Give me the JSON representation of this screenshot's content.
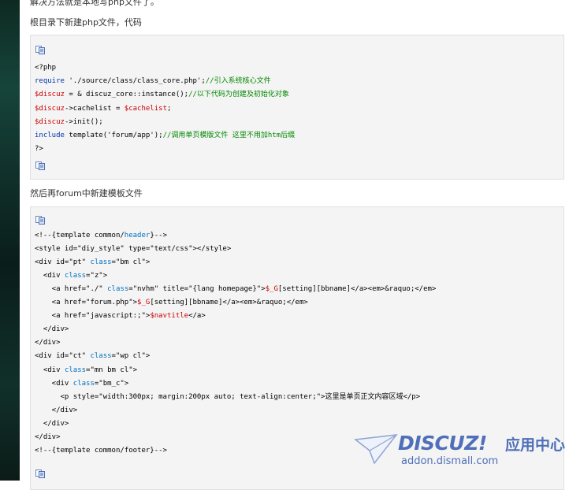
{
  "article": {
    "para_top": "解决方法就是本地写php文件了。",
    "para_1": "根目录下新建php文件，代码",
    "para_2": "然后再forum中新建模板文件"
  },
  "icons": {
    "copy": "copy-code-icon"
  },
  "code_php": {
    "lines": [
      [
        {
          "t": "<?php",
          "c": "str"
        }
      ],
      [
        {
          "t": "require",
          "c": "kw"
        },
        {
          "t": " './source/class/class_core.php';",
          "c": "str"
        },
        {
          "t": "//引入系统核心文件",
          "c": "cmt"
        }
      ],
      [
        {
          "t": "$discuz",
          "c": "var"
        },
        {
          "t": " = & discuz_core::instance();",
          "c": "str"
        },
        {
          "t": "//以下代码为创建及初始化对象",
          "c": "cmt"
        }
      ],
      [
        {
          "t": "$discuz",
          "c": "var"
        },
        {
          "t": "->cachelist = ",
          "c": "str"
        },
        {
          "t": "$cachelist",
          "c": "var"
        },
        {
          "t": ";",
          "c": "str"
        }
      ],
      [
        {
          "t": "$discuz",
          "c": "var"
        },
        {
          "t": "->init();",
          "c": "str"
        }
      ],
      [
        {
          "t": "include",
          "c": "kw"
        },
        {
          "t": " template('forum/app');",
          "c": "str"
        },
        {
          "t": "//调用单页模版文件 这里不用加htm后缀",
          "c": "cmt"
        }
      ],
      [
        {
          "t": "?>",
          "c": "str"
        }
      ]
    ]
  },
  "code_tpl": {
    "lines": [
      [
        {
          "t": "<!--{template common/",
          "c": "tg"
        },
        {
          "t": "header",
          "c": "tk"
        },
        {
          "t": "}-->",
          "c": "tg"
        }
      ],
      [
        {
          "t": "<style id=\"diy_style\" type=\"text/css\"></style>",
          "c": "tg"
        }
      ],
      [
        {
          "t": "<div id=\"pt\" ",
          "c": "tg"
        },
        {
          "t": "class",
          "c": "tk"
        },
        {
          "t": "=\"bm cl\">",
          "c": "tg"
        }
      ],
      [
        {
          "t": "  <div ",
          "c": "tg"
        },
        {
          "t": "class",
          "c": "tk"
        },
        {
          "t": "=\"z\">",
          "c": "tg"
        }
      ],
      [
        {
          "t": "    <a href=\"./\" ",
          "c": "tg"
        },
        {
          "t": "class",
          "c": "tk"
        },
        {
          "t": "=\"nvhm\" title=\"{lang homepage}\">",
          "c": "tg"
        },
        {
          "t": "$_G",
          "c": "var"
        },
        {
          "t": "[setting][bbname]</a><em>&raquo;</em>",
          "c": "tg"
        }
      ],
      [
        {
          "t": "    <a href=\"forum.php\">",
          "c": "tg"
        },
        {
          "t": "$_G",
          "c": "var"
        },
        {
          "t": "[setting][bbname]</a><em>&raquo;</em>",
          "c": "tg"
        }
      ],
      [
        {
          "t": "    <a href=\"javascript:;\">",
          "c": "tg"
        },
        {
          "t": "$navtitle",
          "c": "var"
        },
        {
          "t": "</a>",
          "c": "tg"
        }
      ],
      [
        {
          "t": "  </div>",
          "c": "tg"
        }
      ],
      [
        {
          "t": "</div>",
          "c": "tg"
        }
      ],
      [
        {
          "t": "<div id=\"ct\" ",
          "c": "tg"
        },
        {
          "t": "class",
          "c": "tk"
        },
        {
          "t": "=\"wp cl\">",
          "c": "tg"
        }
      ],
      [
        {
          "t": "  <div ",
          "c": "tg"
        },
        {
          "t": "class",
          "c": "tk"
        },
        {
          "t": "=\"mn bm cl\">",
          "c": "tg"
        }
      ],
      [
        {
          "t": "    <div ",
          "c": "tg"
        },
        {
          "t": "class",
          "c": "tk"
        },
        {
          "t": "=\"bm_c\">",
          "c": "tg"
        }
      ],
      [
        {
          "t": "      <p style=\"width:300px; margin:200px auto; text-align:center;\">这里是单页正文内容区域</p>",
          "c": "tg"
        }
      ],
      [
        {
          "t": "    </div>",
          "c": "tg"
        }
      ],
      [
        {
          "t": "  </div>",
          "c": "tg"
        }
      ],
      [
        {
          "t": "</div>",
          "c": "tg"
        }
      ],
      [
        {
          "t": "<!--{template common/footer}-->",
          "c": "tg"
        }
      ]
    ]
  },
  "watermark": {
    "brand": "DISCUZ!",
    "cn": "应用中心",
    "url": "addon.dismall.com"
  },
  "colors": {
    "keyword": "#0033aa",
    "variable": "#cc0000",
    "comment": "#008800",
    "tag_keyword": "#0070c0",
    "watermark": "#4f6fb8",
    "code_bg": "#f4f4f4"
  }
}
